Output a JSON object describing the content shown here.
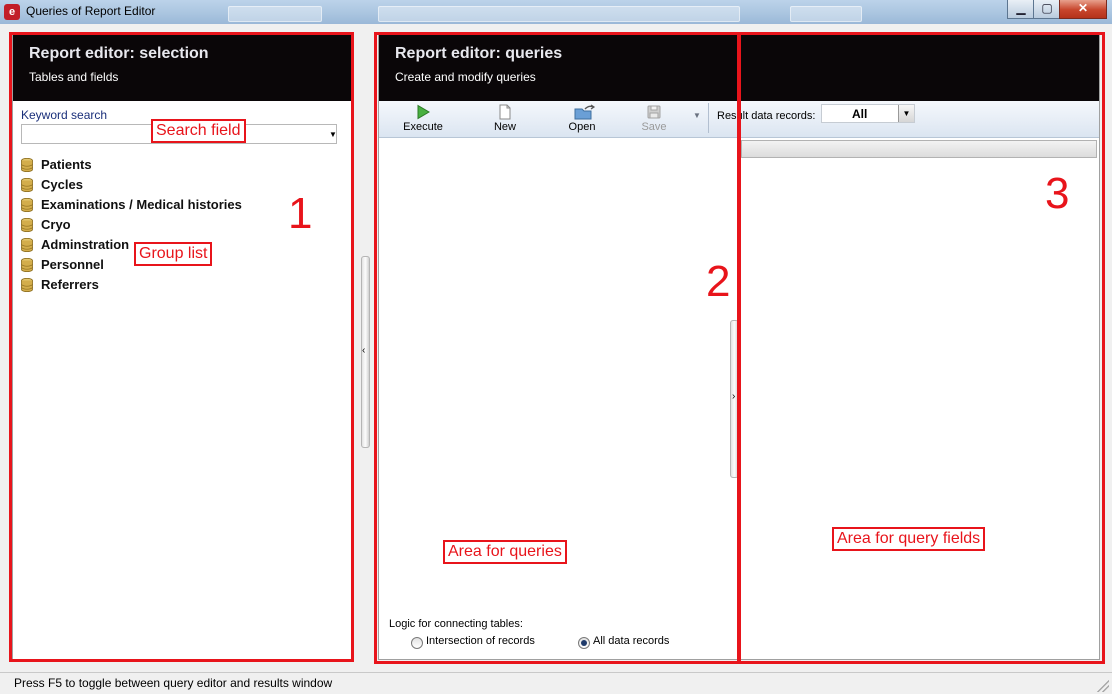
{
  "window": {
    "title": "Queries of Report Editor",
    "icon": "app-logo-icon",
    "controls": [
      "minimize-icon",
      "maximize-icon",
      "close-icon"
    ]
  },
  "left_panel": {
    "title": "Report editor: selection",
    "subtitle": "Tables and fields",
    "keyword_label": "Keyword search",
    "keyword_value": "",
    "groups": [
      {
        "label": "Patients",
        "icon": "database-icon"
      },
      {
        "label": "Cycles",
        "icon": "database-icon"
      },
      {
        "label": "Examinations / Medical histories",
        "icon": "database-icon"
      },
      {
        "label": "Cryo",
        "icon": "database-icon"
      },
      {
        "label": "Adminstration",
        "icon": "database-icon"
      },
      {
        "label": "Personnel",
        "icon": "database-icon"
      },
      {
        "label": "Referrers",
        "icon": "database-icon"
      }
    ]
  },
  "right_panel": {
    "title": "Report editor: queries",
    "subtitle": "Create and modify queries",
    "toolbar": {
      "execute": "Execute",
      "new": "New",
      "open": "Open",
      "save": "Save",
      "result_label": "Result data records:",
      "result_value": "All"
    },
    "logic_label": "Logic for connecting tables:",
    "logic_options": [
      {
        "label": "Intersection of records",
        "selected": false
      },
      {
        "label": "All data records",
        "selected": true
      }
    ]
  },
  "annotations": {
    "search_field": "Search field",
    "group_list": "Group list",
    "area_queries": "Area for queries",
    "area_fields": "Area for query fields",
    "num1": "1",
    "num2": "2",
    "num3": "3",
    "color": "#e8141b"
  },
  "statusbar": {
    "text": "Press F5 to toggle between query editor and results window"
  }
}
